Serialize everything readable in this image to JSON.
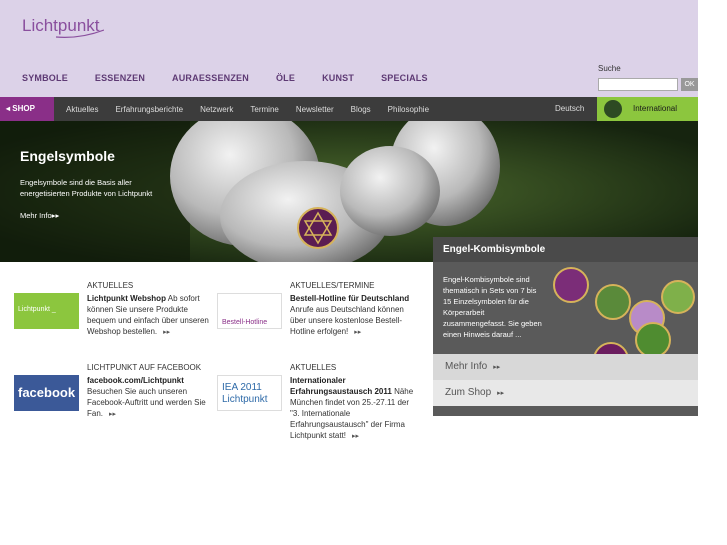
{
  "header": {
    "logo": "Lichtpunkt",
    "nav": [
      "SYMBOLE",
      "ESSENZEN",
      "AURAESSENZEN",
      "ÖLE",
      "KUNST",
      "SPECIALS"
    ],
    "search_label": "Suche",
    "search_value": "",
    "search_button": "OK"
  },
  "subnav": {
    "shop": "SHOP",
    "links": [
      "Aktuelles",
      "Erfahrungsberichte",
      "Netzwerk",
      "Termine",
      "Newsletter",
      "Blogs",
      "Philosophie"
    ],
    "language": "Deutsch",
    "international": "International"
  },
  "hero": {
    "title": "Engelsymbole",
    "text": "Engelsymbole sind die Basis aller energetisierten Produkte von Lichtpunkt",
    "more": "Mehr Info"
  },
  "side": {
    "title": "Engel-Kombisymbole",
    "text": "Engel-Kombisymbole sind thematisch in Sets von 7 bis 15 Einzelsymbolen für die Körperarbeit zusammengefasst. Sie geben einen Hinweis darauf ...",
    "link_more": "Mehr Info",
    "link_shop": "Zum Shop"
  },
  "news": [
    {
      "head": "AKTUELLES",
      "title": "Lichtpunkt Webshop",
      "body": "Ab sofort können Sie unsere Produkte bequem und einfach über unseren Webshop bestellen.",
      "image_text": "Lichtpunkt _ STORE"
    },
    {
      "head": "AKTUELLES/TERMINE",
      "title": "Bestell-Hotline für Deutschland",
      "body": "Anrufe aus Deutschland können über unsere kostenlose Bestell-Hotline erfolgen!",
      "image_text": "Bestell-Hotline"
    },
    {
      "head": "LICHTPUNKT AUF FACEBOOK",
      "title": "facebook.com/Lichtpunkt",
      "body": "Besuchen Sie auch unseren Facebook-Auftritt und werden Sie Fan.",
      "image_text": "facebook"
    },
    {
      "head": "AKTUELLES",
      "title": "Internationaler Erfahrungsaustausch 2011",
      "body": "Nähe München findet von 25.-27.11 der \"3. Internationale Erfahrungsaustausch\" der Firma Lichtpunkt statt!",
      "image_text": "IEA 2011 Lichtpunkt"
    }
  ],
  "colors": {
    "accent": "#8a2f88",
    "header_bg": "#dcd2e8",
    "nav_text": "#5e3a74",
    "international": "#8cc63e"
  }
}
